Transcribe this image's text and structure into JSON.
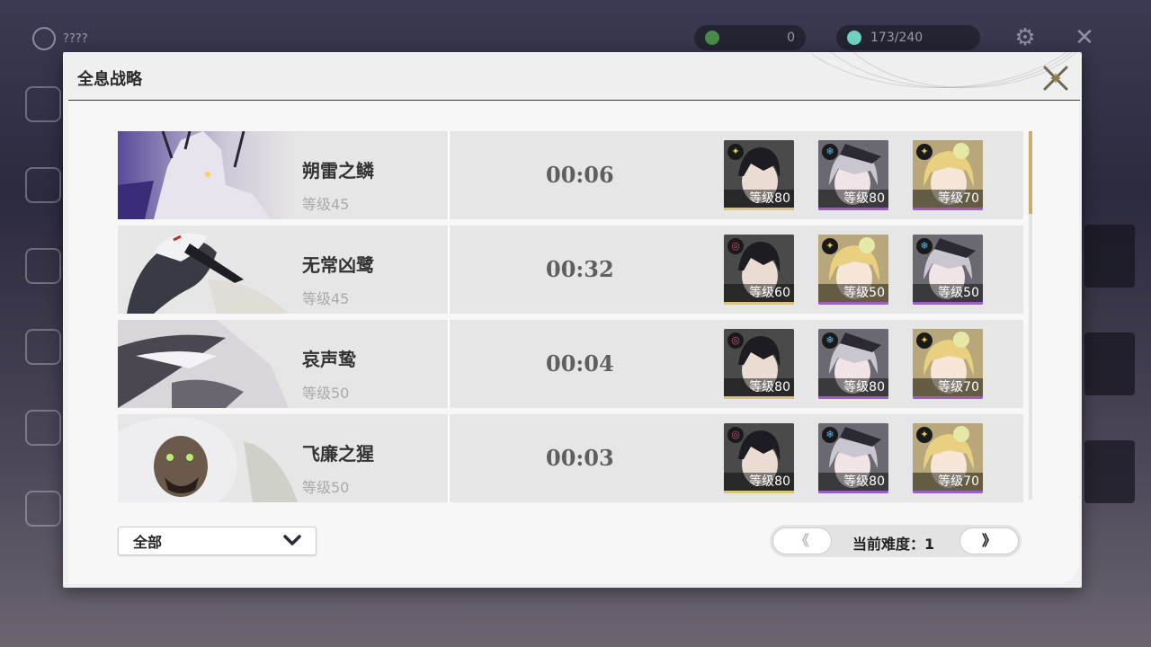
{
  "background": {
    "title": "????",
    "resource1_value": "0",
    "resource2_value": "173/240"
  },
  "modal": {
    "title": "全息战略"
  },
  "rows": [
    {
      "boss_name": "朔雷之鳞",
      "boss_level": "等级45",
      "time": "00:06",
      "team": [
        {
          "level": "等级80",
          "element": "electro",
          "rarity": "gold"
        },
        {
          "level": "等级80",
          "element": "glacio",
          "rarity": "purple"
        },
        {
          "level": "等级70",
          "element": "electro",
          "rarity": "purple"
        }
      ]
    },
    {
      "boss_name": "无常凶鹭",
      "boss_level": "等级45",
      "time": "00:32",
      "team": [
        {
          "level": "等级60",
          "element": "havoc",
          "rarity": "gold"
        },
        {
          "level": "等级50",
          "element": "electro",
          "rarity": "purple"
        },
        {
          "level": "等级50",
          "element": "glacio",
          "rarity": "purple"
        }
      ]
    },
    {
      "boss_name": "哀声鸷",
      "boss_level": "等级50",
      "time": "00:04",
      "team": [
        {
          "level": "等级80",
          "element": "havoc",
          "rarity": "gold"
        },
        {
          "level": "等级80",
          "element": "glacio",
          "rarity": "purple"
        },
        {
          "level": "等级70",
          "element": "electro",
          "rarity": "purple"
        }
      ]
    },
    {
      "boss_name": "飞廉之猩",
      "boss_level": "等级50",
      "time": "00:03",
      "team": [
        {
          "level": "等级80",
          "element": "havoc",
          "rarity": "gold"
        },
        {
          "level": "等级80",
          "element": "glacio",
          "rarity": "purple"
        },
        {
          "level": "等级70",
          "element": "electro",
          "rarity": "purple"
        }
      ]
    }
  ],
  "filter": {
    "selected": "全部",
    "icon": "chevron-down-icon"
  },
  "pager": {
    "prev_label": "《",
    "next_label": "》",
    "difficulty_label": "当前难度：1"
  },
  "colors": {
    "gold": "#d8c67a",
    "purple": "#9b5ec9",
    "electro": "#e8c84a",
    "glacio": "#5ab6e8",
    "havoc": "#d04a8a",
    "accent": "#c9ad6f"
  }
}
